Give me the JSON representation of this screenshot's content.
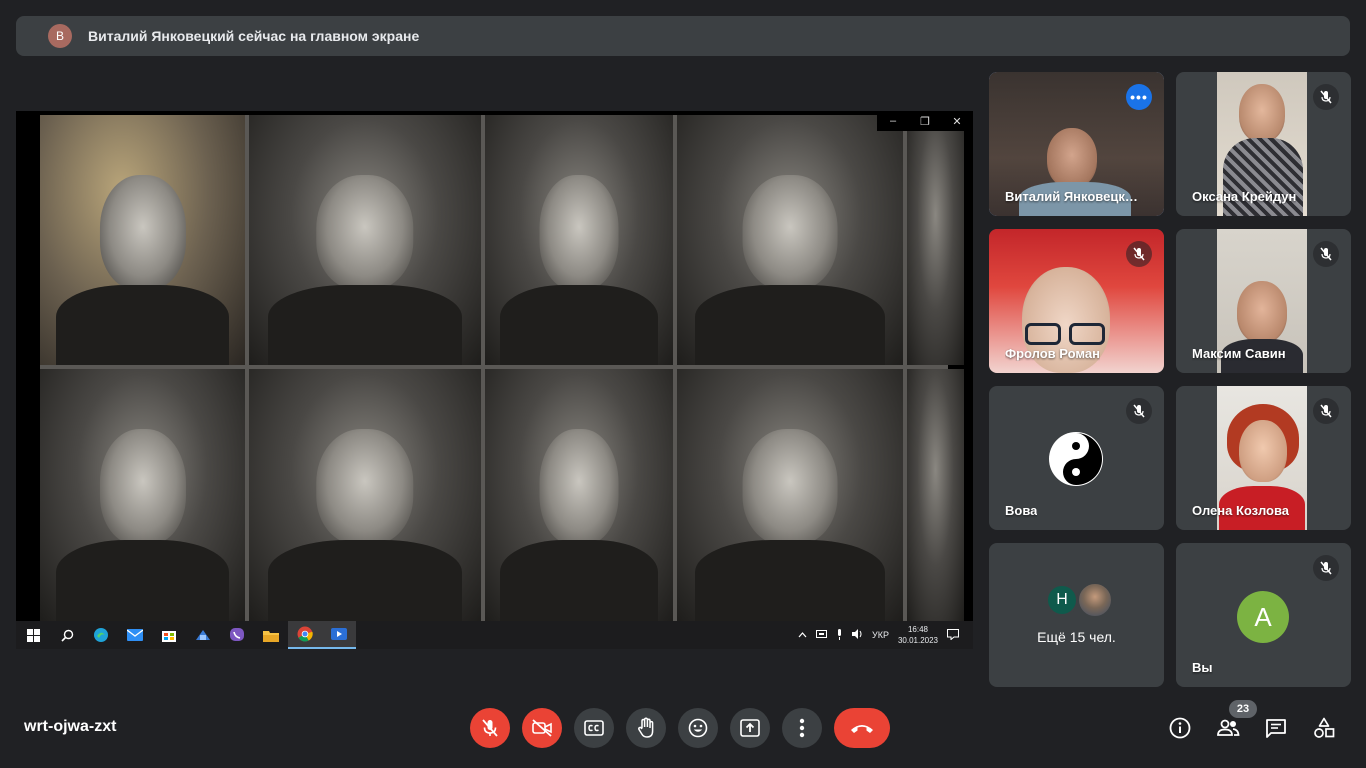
{
  "banner": {
    "avatar_letter": "В",
    "text": "Виталий Янковецкий сейчас на главном экране"
  },
  "presentation": {
    "window_controls": [
      "–",
      "❐",
      "✕"
    ],
    "taskbar": {
      "icons": [
        "windows-start-icon",
        "search-icon",
        "edge-icon",
        "mail-icon",
        "store-icon",
        "app-icon",
        "viber-icon",
        "explorer-icon",
        "chrome-icon",
        "player-icon"
      ],
      "language": "УКР",
      "time": "16:48",
      "date": "30.01.2023"
    }
  },
  "participants": [
    {
      "name": "Виталий Янковецк…",
      "speaking": true
    },
    {
      "name": "Оксана Крейдун",
      "muted": true
    },
    {
      "name": "Фролов Роман",
      "muted": true
    },
    {
      "name": "Максим Савин",
      "muted": true
    },
    {
      "name": "Вова",
      "muted": true
    },
    {
      "name": "Олена Козлова",
      "muted": true
    }
  ],
  "more_tile": {
    "avatar_letter": "Н",
    "label": "Ещё 15 чел."
  },
  "self_tile": {
    "avatar_letter": "А",
    "name": "Вы",
    "muted": true
  },
  "meeting": {
    "code": "wrt-ojwa-zxt",
    "participant_count": "23"
  },
  "colors": {
    "background": "#202124",
    "tile": "#3c4043",
    "danger": "#ea4335",
    "accent": "#8ab4f8"
  }
}
